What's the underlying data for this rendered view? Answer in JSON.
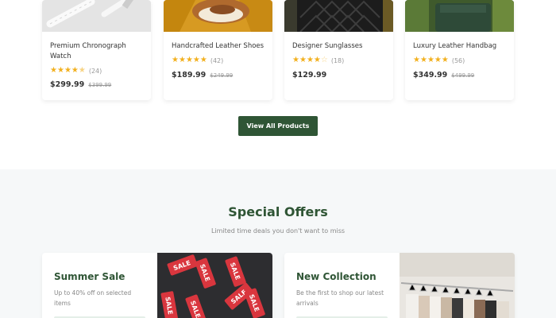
{
  "products": [
    {
      "name": "Premium Chronograph Watch",
      "rating": 4.5,
      "reviews": "(24)",
      "price": "$299.99",
      "old_price": "$399.99",
      "image": "watch-strap-image"
    },
    {
      "name": "Handcrafted Leather Shoes",
      "rating": 5,
      "reviews": "(42)",
      "price": "$189.99",
      "old_price": "$249.99",
      "image": "leather-shoes-image"
    },
    {
      "name": "Designer Sunglasses",
      "rating": 4,
      "reviews": "(18)",
      "price": "$129.99",
      "old_price": "",
      "image": "quilted-bag-image"
    },
    {
      "name": "Luxury Leather Handbag",
      "rating": 5,
      "reviews": "(56)",
      "price": "$349.99",
      "old_price": "$499.99",
      "image": "green-handbag-image"
    }
  ],
  "view_all_label": "View All Products",
  "offers": {
    "title": "Special Offers",
    "subtitle": "Limited time deals you don't want to miss",
    "cards": [
      {
        "title": "Summer Sale",
        "description": "Up to 40% off on selected items",
        "image": "sale-tags-image",
        "tag_text": "SALE"
      },
      {
        "title": "New Collection",
        "description": "Be the first to shop our latest arrivals",
        "image": "clothing-rack-image"
      }
    ]
  },
  "colors": {
    "brand_green": "#2f5535",
    "star_gold": "#f2b01e",
    "section_bg": "#f6f8f9"
  }
}
